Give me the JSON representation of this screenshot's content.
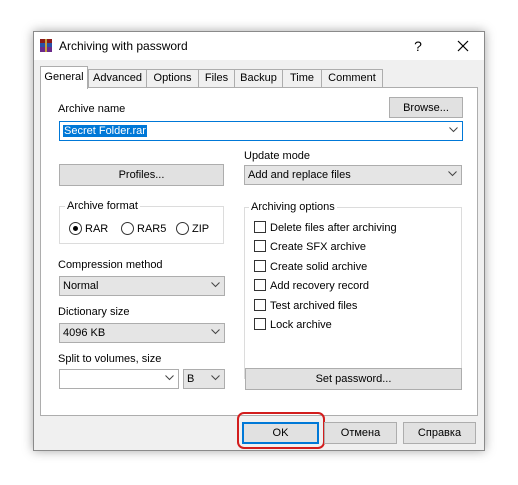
{
  "window": {
    "title": "Archiving with password",
    "help_glyph": "?",
    "icon": "winrar-icon",
    "close_icon": "close-icon"
  },
  "tabs": [
    "General",
    "Advanced",
    "Options",
    "Files",
    "Backup",
    "Time",
    "Comment"
  ],
  "general": {
    "archive_name_label": "Archive name",
    "archive_name_value": "Secret Folder.rar",
    "browse_button": "Browse...",
    "profiles_button": "Profiles...",
    "update_mode_label": "Update mode",
    "update_mode_value": "Add and replace files",
    "archive_format_label": "Archive format",
    "formats": [
      "RAR",
      "RAR5",
      "ZIP"
    ],
    "selected_format": "RAR",
    "compression_label": "Compression method",
    "compression_value": "Normal",
    "dictionary_label": "Dictionary size",
    "dictionary_value": "4096 KB",
    "split_label": "Split to volumes, size",
    "split_value": "",
    "split_unit": "B",
    "set_password_button": "Set password...",
    "archiving_options_label": "Archiving options",
    "options": [
      "Delete files after archiving",
      "Create SFX archive",
      "Create solid archive",
      "Add recovery record",
      "Test archived files",
      "Lock archive"
    ]
  },
  "footer": {
    "ok": "OK",
    "cancel": "Отмена",
    "help": "Справка"
  }
}
